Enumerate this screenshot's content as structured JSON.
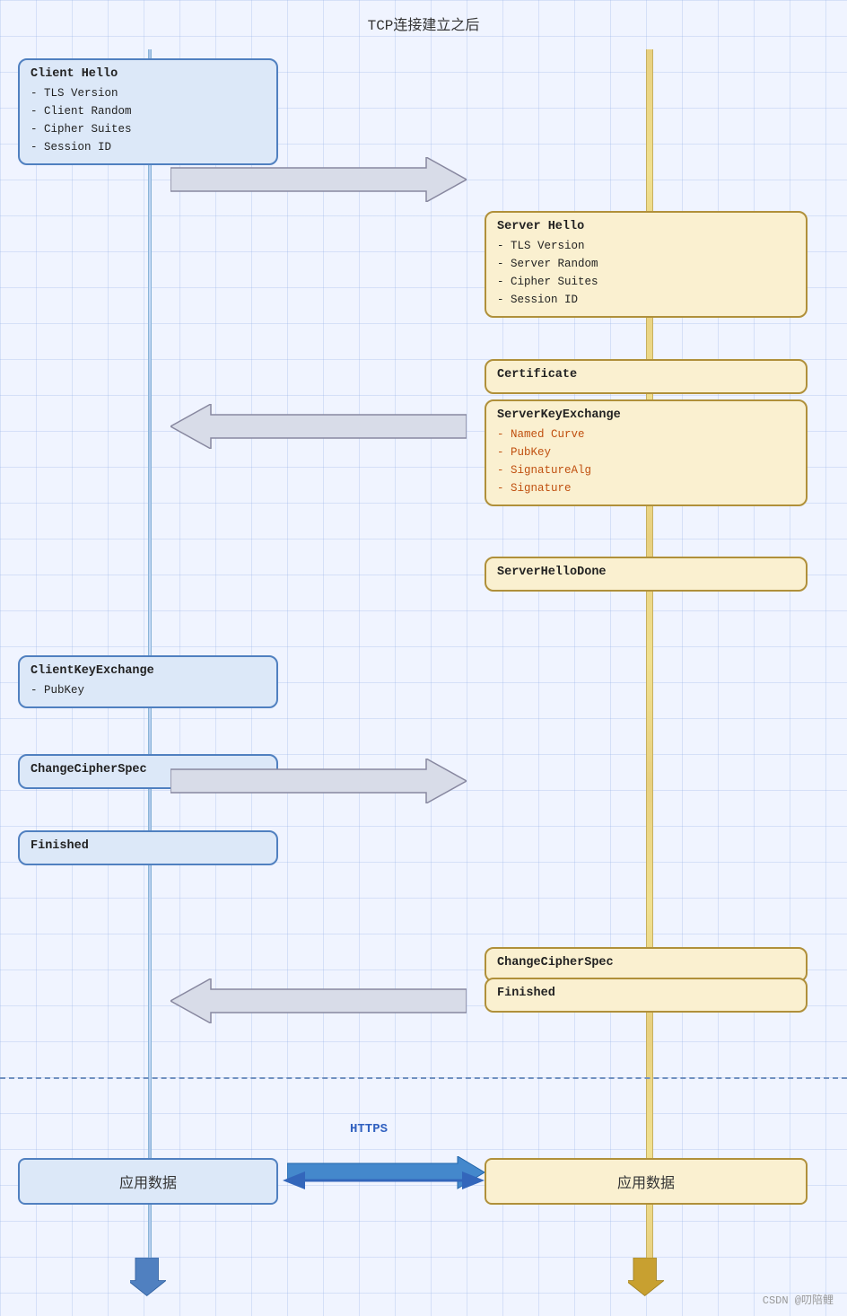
{
  "diagram": {
    "title": "TCP连接建立之后",
    "client_hello": {
      "title": "Client Hello",
      "items": [
        "- TLS Version",
        "- Client Random",
        "- Cipher Suites",
        "- Session ID"
      ]
    },
    "server_hello": {
      "title": "Server Hello",
      "items": [
        "- TLS Version",
        "- Server Random",
        "- Cipher Suites",
        "- Session ID"
      ]
    },
    "certificate": {
      "title": "Certificate"
    },
    "server_key_exchange": {
      "title": "ServerKeyExchange",
      "items": [
        "- Named Curve",
        "- PubKey",
        "- SignatureAlg",
        "- Signature"
      ]
    },
    "server_hello_done": {
      "title": "ServerHelloDone"
    },
    "client_key_exchange": {
      "title": "ClientKeyExchange",
      "items": [
        "- PubKey"
      ]
    },
    "change_cipher_spec_client": {
      "title": "ChangeCipherSpec"
    },
    "finished_client": {
      "title": "Finished"
    },
    "change_cipher_spec_server": {
      "title": "ChangeCipherSpec"
    },
    "finished_server": {
      "title": "Finished"
    },
    "app_data_client": {
      "label": "应用数据"
    },
    "app_data_server": {
      "label": "应用数据"
    },
    "https_label": "HTTPS",
    "watermark": "CSDN @叨陪鲤"
  }
}
